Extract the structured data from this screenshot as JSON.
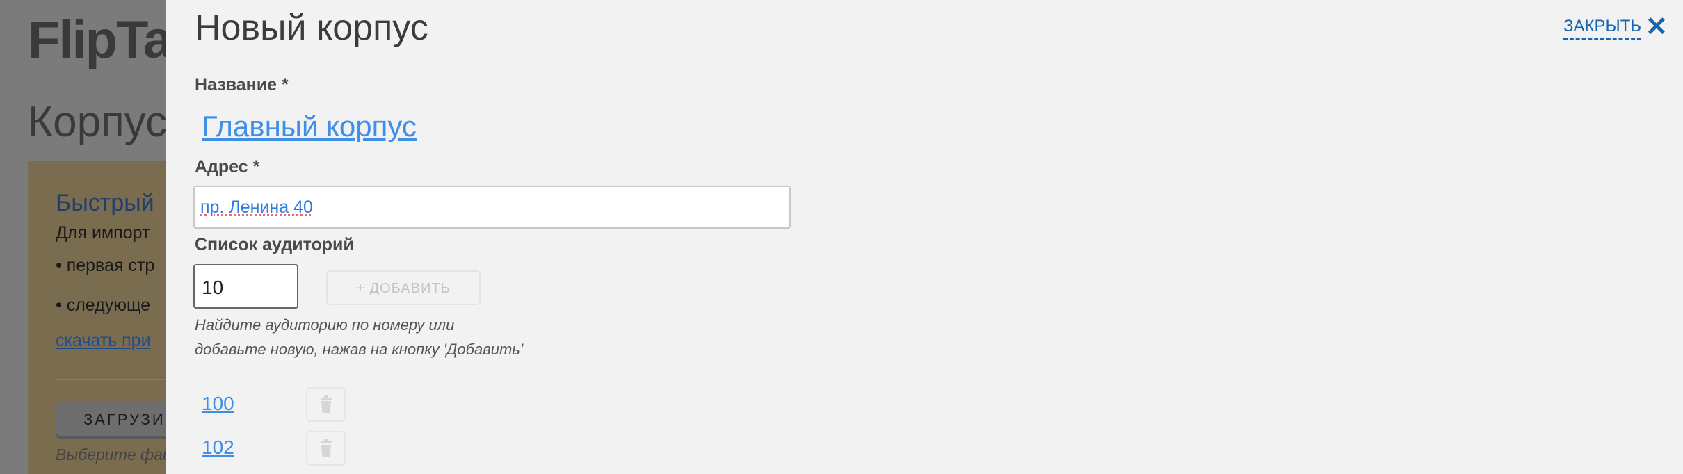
{
  "background": {
    "logo": "FlipTab",
    "title": "Корпуса",
    "import_box": {
      "heading": "Быстрый",
      "text": "Для импорт",
      "bullets": [
        "первая стр",
        "следующе"
      ],
      "link": "скачать при",
      "upload_button": "ЗАГРУЗИТ",
      "file_hint": "Выберите фай"
    }
  },
  "panel": {
    "title": "Новый корпус",
    "close_label": "ЗАКРЫТЬ",
    "name_label": "Название *",
    "name_value": "Главный корпус",
    "address_label": "Адрес *",
    "address_value": "пр. Ленина 40",
    "rooms_label": "Список аудиторий",
    "room_search_value": "10",
    "add_button": "+ ДОБАВИТЬ",
    "hint_lines": [
      "Найдите аудиторию по номеру или",
      "добавьте новую, нажав на кнопку 'Добавить'"
    ],
    "rooms": [
      {
        "number": "100"
      },
      {
        "number": "102"
      }
    ]
  },
  "colors": {
    "accent": "#3d8fe8",
    "close": "#1565b0",
    "panel_bg": "#f2f2f2"
  }
}
